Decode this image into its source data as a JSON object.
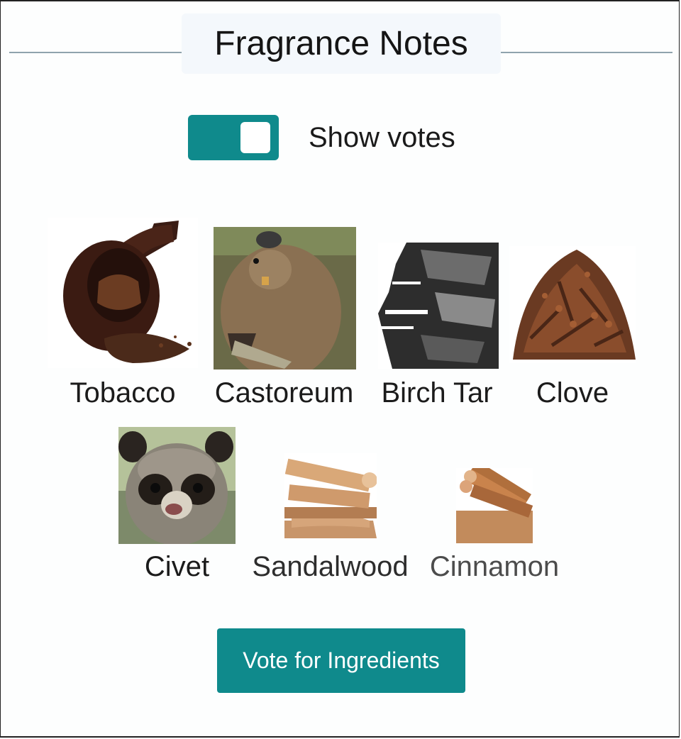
{
  "header": {
    "title": "Fragrance Notes"
  },
  "toggle": {
    "label": "Show votes",
    "on": true
  },
  "notes": [
    {
      "label": "Tobacco",
      "icon": "tobacco-pipe-image"
    },
    {
      "label": "Castoreum",
      "icon": "beaver-image"
    },
    {
      "label": "Birch Tar",
      "icon": "birch-tar-image"
    },
    {
      "label": "Clove",
      "icon": "clove-image"
    },
    {
      "label": "Civet",
      "icon": "civet-image"
    },
    {
      "label": "Sandalwood",
      "icon": "sandalwood-image"
    },
    {
      "label": "Cinnamon",
      "icon": "cinnamon-image"
    }
  ],
  "actions": {
    "vote_label": "Vote for Ingredients"
  },
  "colors": {
    "accent": "#0f8a8c",
    "header_line": "#8fa3ad",
    "header_pill": "#f4f8fc"
  }
}
